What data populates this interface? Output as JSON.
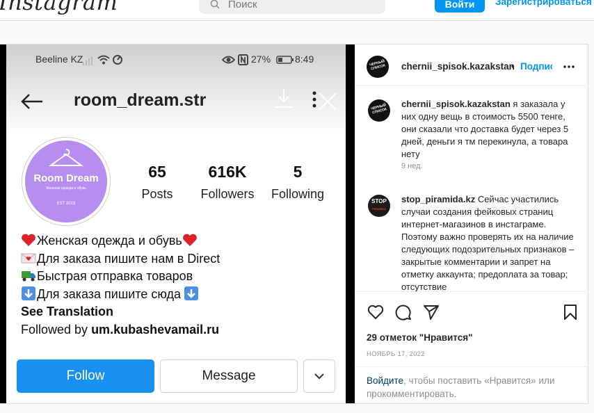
{
  "topbar": {
    "logo": "Instagram",
    "search_placeholder": "Поиск",
    "login_label": "Войти",
    "signup_label": "Зарегистрироваться"
  },
  "phone": {
    "status": {
      "carrier": "Beeline KZ",
      "battery": "27%",
      "time": "8:49"
    },
    "username": "room_dream.str",
    "avatar": {
      "brand": "Room Dream",
      "tagline": "Женская одежда и обувь",
      "est": "EST 2019"
    },
    "stats": [
      {
        "value": "65",
        "label": "Posts"
      },
      {
        "value": "616K",
        "label": "Followers"
      },
      {
        "value": "5",
        "label": "Following"
      }
    ],
    "bio": {
      "line1": "Женская одежда и обувь",
      "line2": "Для заказа пишите нам в Direct",
      "line3": "Быстрая отправка товаров",
      "line4": "Для заказа пишите сюда",
      "see_translation": "See Translation",
      "followed_prefix": "Followed by ",
      "followed_by": "um.kubashevamail.ru"
    },
    "buttons": {
      "follow": "Follow",
      "message": "Message"
    }
  },
  "post": {
    "author": "chernii_spisok.kazakstan",
    "author_avatar_text": "ЧЕРНЫЙ СПИСОК",
    "separator": "•",
    "follow_label": "Подписаться",
    "comments": [
      {
        "user": "chernii_spisok.kazakstan",
        "text": " я заказала у них одну вещь в стоимость 5500 тенге, они сказали что доставка будет через 5 дней, деньги я тм перекинула, а товара нету",
        "time": "9 нед."
      },
      {
        "user": "stop_piramida.kz",
        "avatar_word": "STOP",
        "avatar_sub": "PIRAMIDA",
        "text": " Сейчас участились случаи создания фейковых страниц интернет-магазинов в инстаграме. Поэтому важно проверять их на наличие следующих подозрительных признаков – закрытые комментарии и запрет на отметку аккаунта; предоплата за товар; отсутствие"
      }
    ],
    "likes": "29 отметок \"Нравится\"",
    "date": "НОЯБРЬ 17, 2022",
    "login_link": "Войдите",
    "login_rest": ", чтобы поставить «Нравится» или прокомментировать."
  },
  "colors": {
    "accent": "#0095f6",
    "phone_follow": "#1a8ff2",
    "avatar_purple": "#b58ef0"
  }
}
